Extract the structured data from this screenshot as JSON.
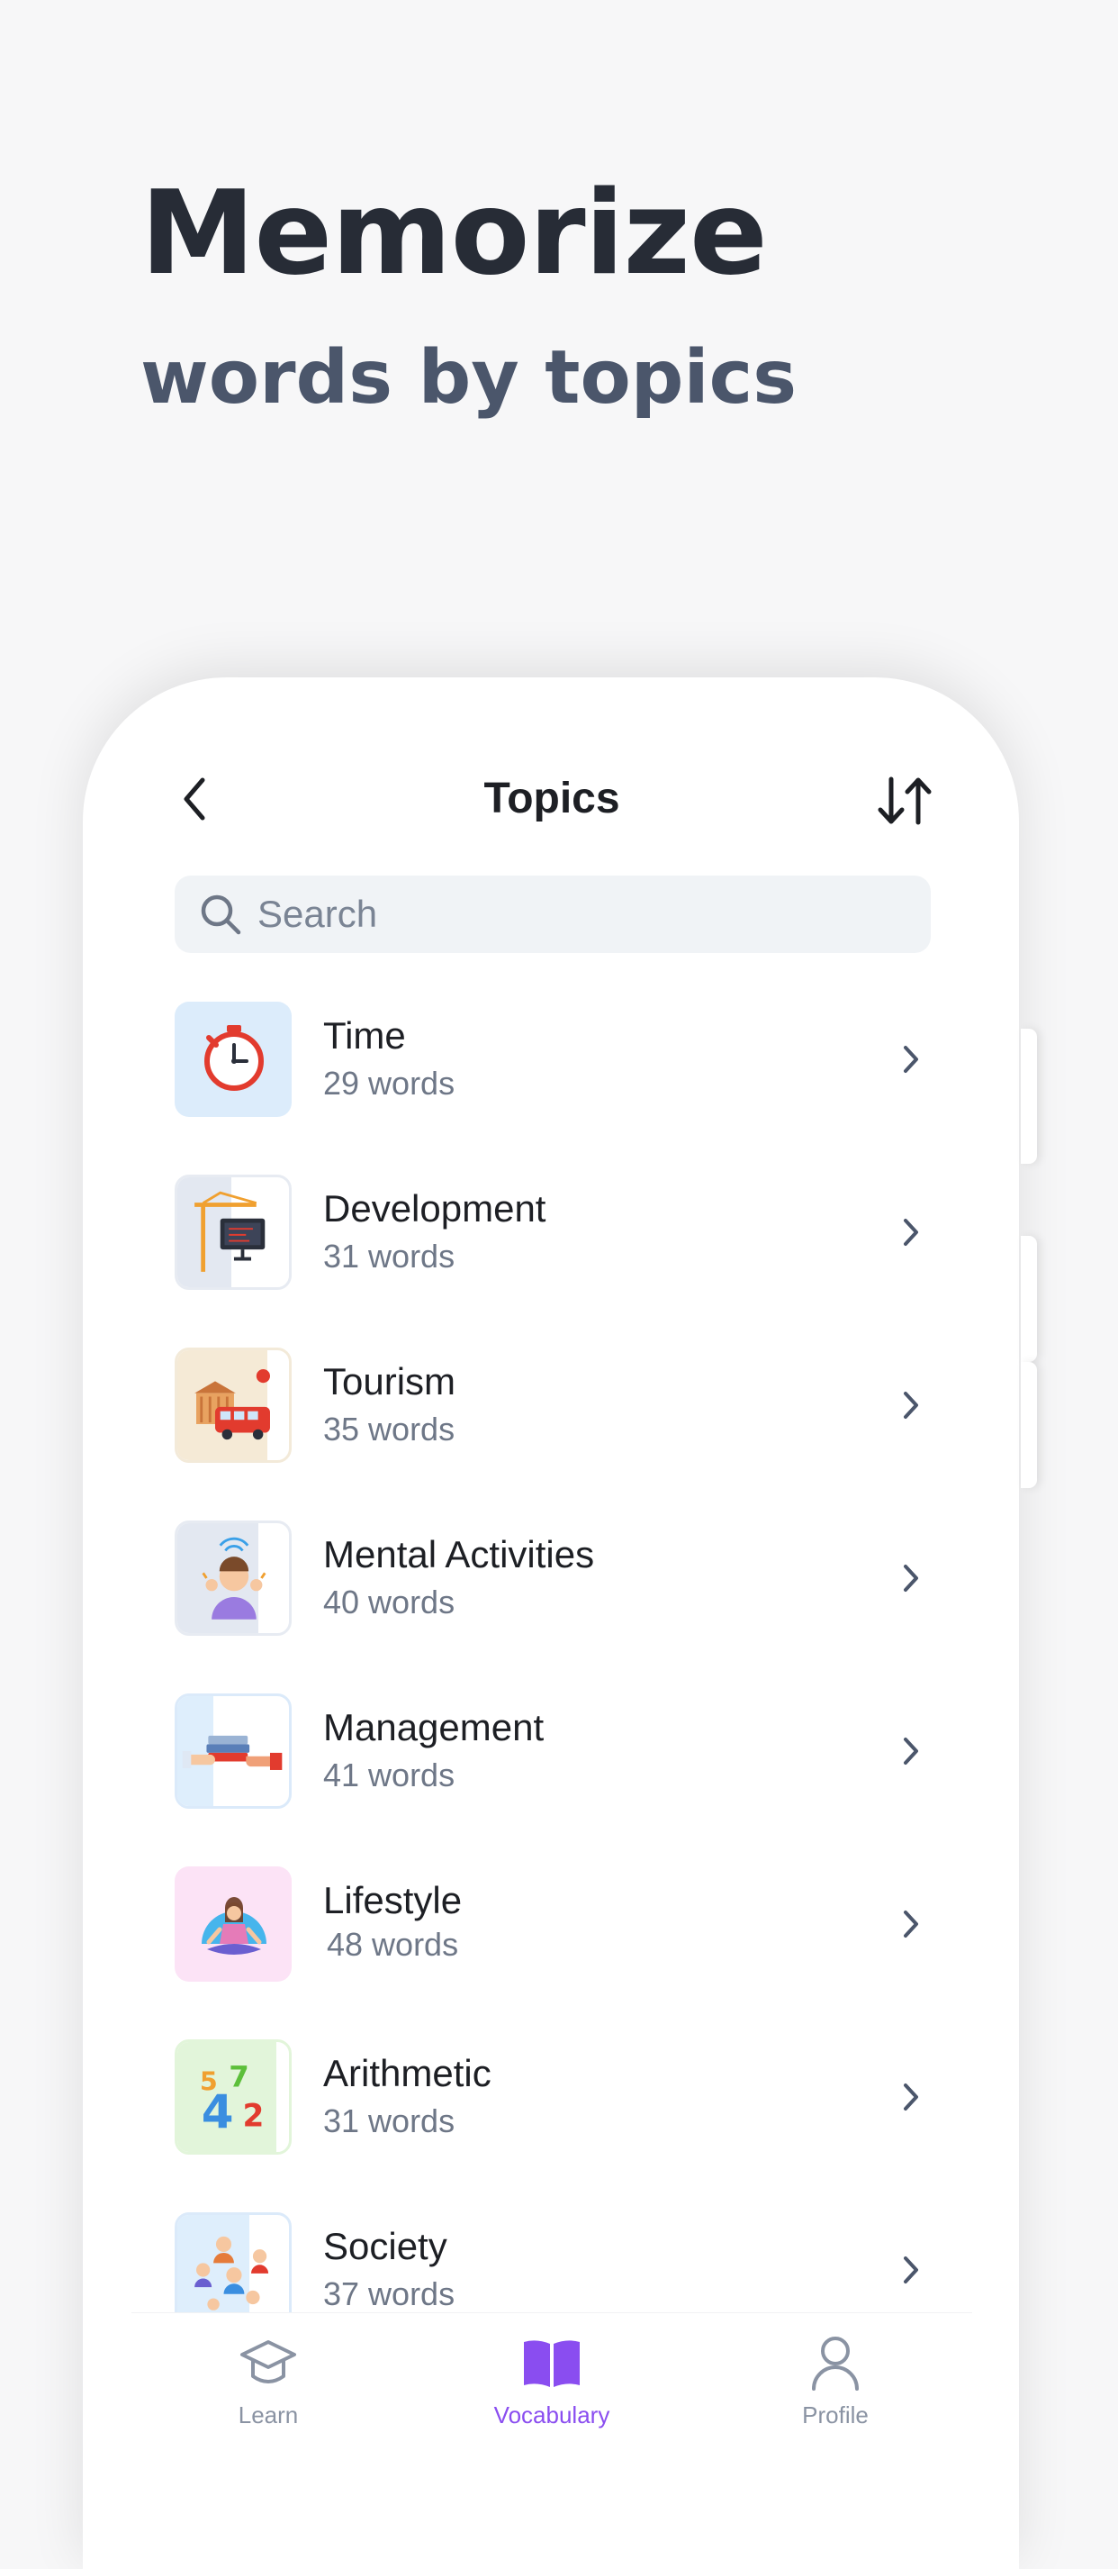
{
  "hero": {
    "title": "Memorize",
    "subtitle": "words by topics"
  },
  "header": {
    "title": "Topics",
    "back_icon": "chevron-left-icon",
    "sort_icon": "sort-arrows-icon"
  },
  "search": {
    "placeholder": "Search",
    "value": ""
  },
  "topics": [
    {
      "name": "Time",
      "count": "29 words",
      "icon": "stopwatch-icon",
      "bg": "#dcecfb"
    },
    {
      "name": "Development",
      "count": "31 words",
      "icon": "crane-computer-icon",
      "bg": "#e3e8f1"
    },
    {
      "name": "Tourism",
      "count": "35 words",
      "icon": "bus-museum-icon",
      "bg": "#f5ead6"
    },
    {
      "name": "Mental Activities",
      "count": "40 words",
      "icon": "thinking-person-icon",
      "bg": "#e3e8f1"
    },
    {
      "name": "Management",
      "count": "41 words",
      "icon": "handing-papers-icon",
      "bg": "#deeefc"
    },
    {
      "name": "Lifestyle",
      "count": "48 words",
      "icon": "meditation-icon",
      "bg": "#fce3f6"
    },
    {
      "name": "Arithmetic",
      "count": "31 words",
      "icon": "numbers-icon",
      "bg": "#e2f5da"
    },
    {
      "name": "Society",
      "count": "37 words",
      "icon": "people-group-icon",
      "bg": "#deeefc"
    }
  ],
  "tabs": [
    {
      "label": "Learn",
      "icon": "graduation-cap-icon",
      "active": false
    },
    {
      "label": "Vocabulary",
      "icon": "open-book-icon",
      "active": true
    },
    {
      "label": "Profile",
      "icon": "user-icon",
      "active": false
    }
  ],
  "colors": {
    "accent": "#8a4df0",
    "text": "#1d1f24",
    "muted": "#6e7787",
    "headline": "#272c36",
    "subheadline": "#4b566b"
  }
}
